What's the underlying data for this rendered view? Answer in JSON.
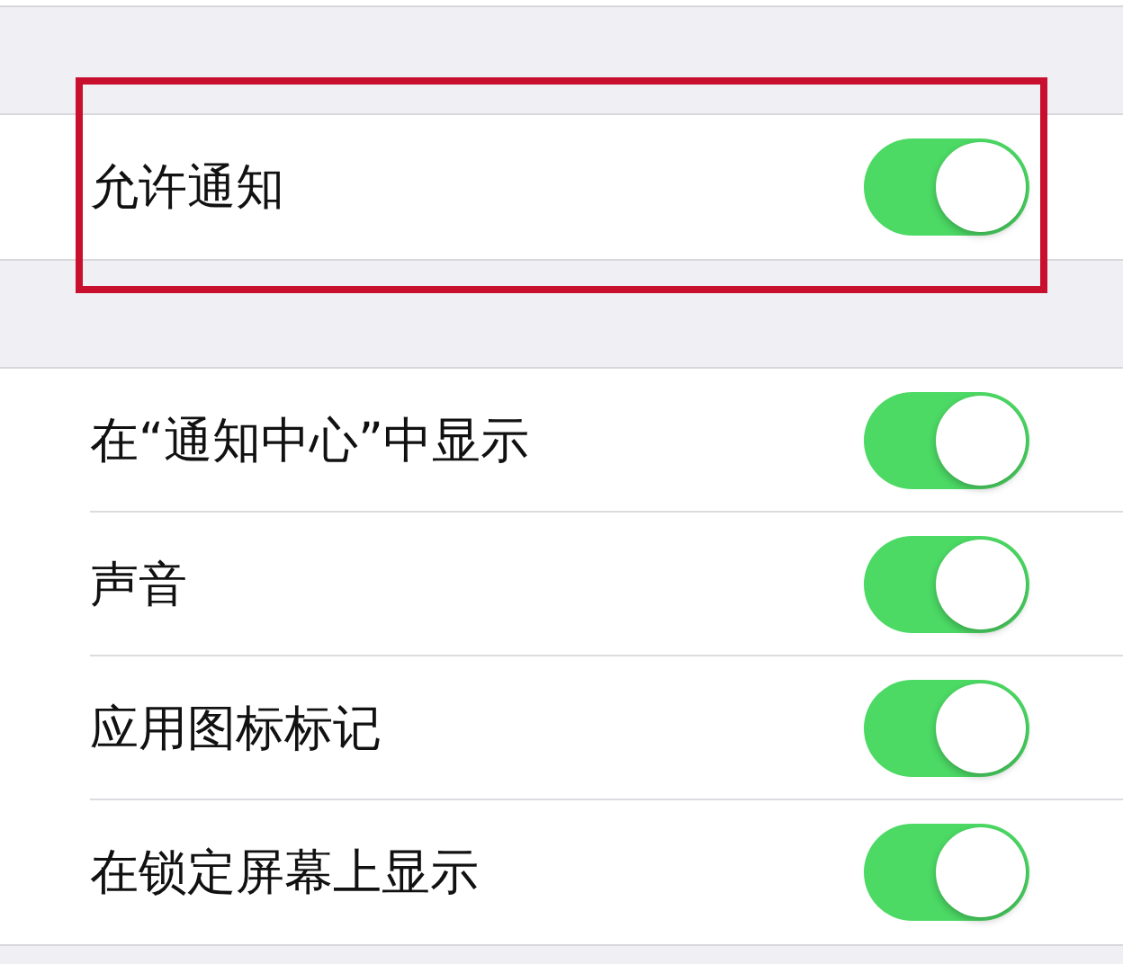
{
  "groups": [
    {
      "highlighted": true,
      "rows": [
        {
          "label": "允许通知",
          "on": true
        }
      ]
    },
    {
      "highlighted": false,
      "rows": [
        {
          "label": "在“通知中心”中显示",
          "on": true
        },
        {
          "label": "声音",
          "on": true
        },
        {
          "label": "应用图标标记",
          "on": true
        },
        {
          "label": "在锁定屏幕上显示",
          "on": true
        }
      ]
    }
  ]
}
